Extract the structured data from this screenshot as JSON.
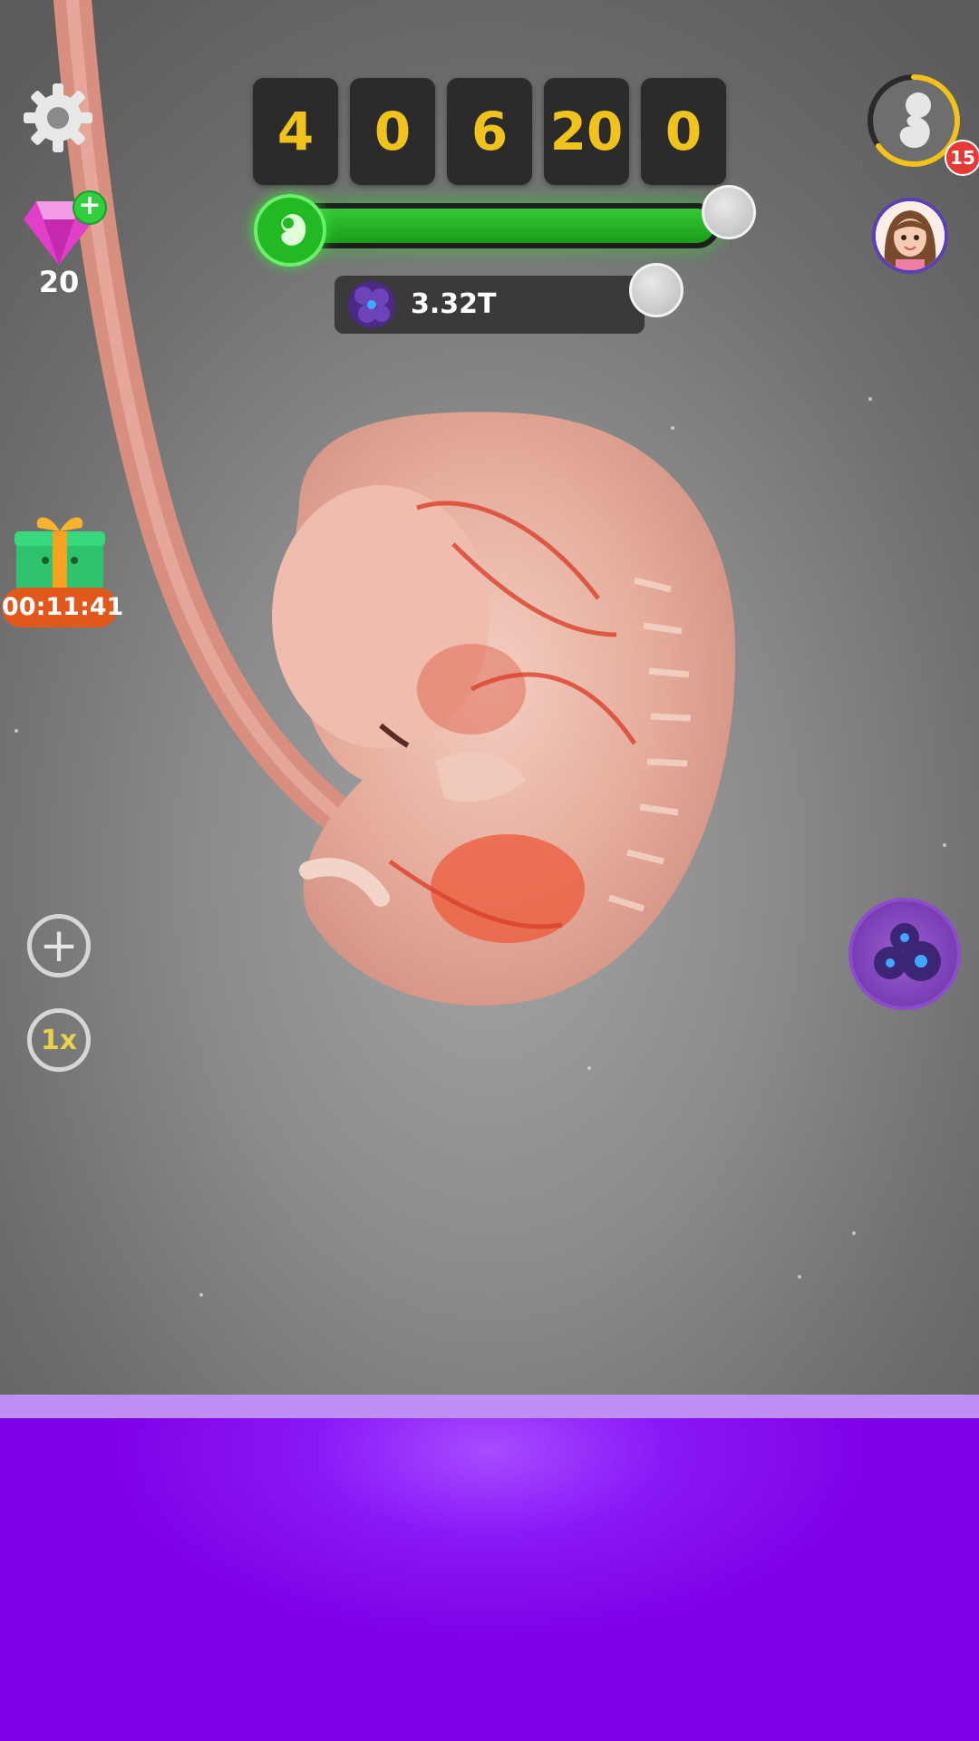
{
  "counters": [
    {
      "value": "4"
    },
    {
      "value": "0"
    },
    {
      "value": "6"
    },
    {
      "value": "20"
    },
    {
      "value": "0"
    }
  ],
  "progress": {
    "fill_fraction": 1.0,
    "color": "#22b022"
  },
  "cells": {
    "value": "3.32T"
  },
  "gems": {
    "count": "20"
  },
  "gift": {
    "timer": "00:11:41"
  },
  "speed": {
    "label": "1x"
  },
  "plus": {
    "label": "+"
  },
  "level": {
    "badge": "15",
    "ring_fraction": 0.65
  },
  "icons": [
    "gear-icon",
    "gem-icon",
    "plus-badge-icon",
    "gift-icon",
    "embryo-stage-icon",
    "cell-icon",
    "avatar-icon",
    "cell-cluster-icon"
  ],
  "colors": {
    "accent_yellow": "#f0c21c",
    "green": "#23b923",
    "purple": "#8a18f7",
    "timer_orange": "#e0581b",
    "badge_red": "#e53935"
  }
}
